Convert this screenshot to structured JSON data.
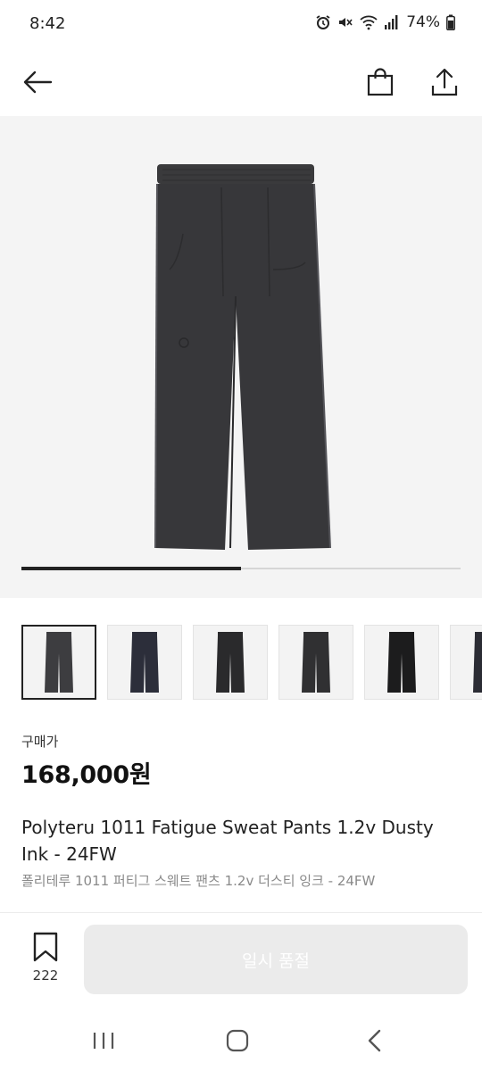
{
  "status": {
    "time": "8:42",
    "battery": "74%",
    "icons": [
      "alarm-icon",
      "mute-icon",
      "wifi-icon",
      "signal-icon",
      "battery-icon"
    ]
  },
  "nav": {
    "icons": [
      "back-arrow-icon",
      "shopping-bag-icon",
      "share-icon"
    ]
  },
  "gallery": {
    "thumb_count": 6,
    "active_index": 0,
    "progress": 0.5
  },
  "product": {
    "price_label": "구매가",
    "price": "168,000원",
    "title_en": "Polyteru 1011 Fatigue Sweat Pants 1.2v Dusty Ink - 24FW",
    "title_ko": "폴리테루 1011 퍼티그 스웨트 팬츠 1.2v 더스티 잉크 - 24FW"
  },
  "actions": {
    "bookmark_count": "222",
    "sold_out_label": "일시 품절"
  },
  "system_nav": {
    "icons": [
      "recent-apps-icon",
      "home-icon",
      "back-icon"
    ]
  }
}
